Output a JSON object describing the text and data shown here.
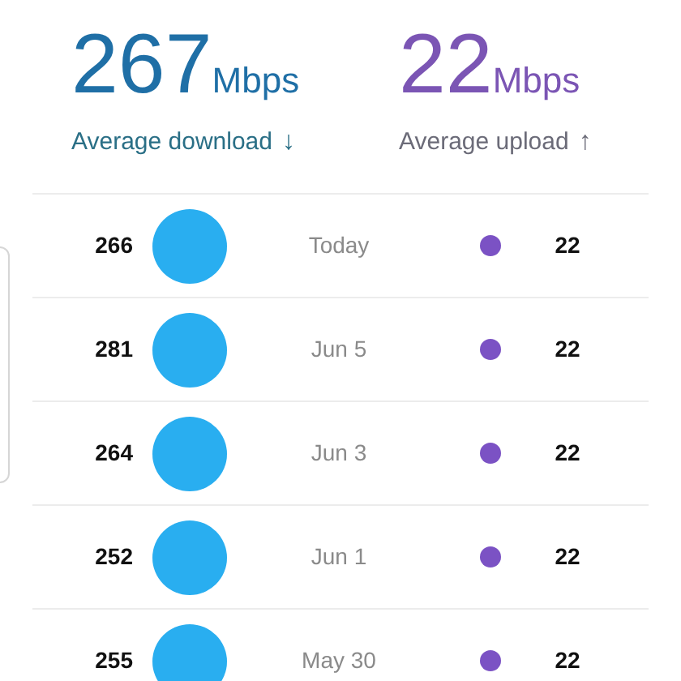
{
  "summary": [
    {
      "kind": "download",
      "value": "267",
      "unit": "Mbps",
      "label": "Average download",
      "arrow": "↓"
    },
    {
      "kind": "upload",
      "value": "22",
      "unit": "Mbps",
      "label": "Average upload",
      "arrow": "↑"
    }
  ],
  "results": [
    {
      "download": "266",
      "date": "Today",
      "upload": "22"
    },
    {
      "download": "281",
      "date": "Jun 5",
      "upload": "22"
    },
    {
      "download": "264",
      "date": "Jun 3",
      "upload": "22"
    },
    {
      "download": "252",
      "date": "Jun 1",
      "upload": "22"
    },
    {
      "download": "255",
      "date": "May 30",
      "upload": "22"
    }
  ]
}
